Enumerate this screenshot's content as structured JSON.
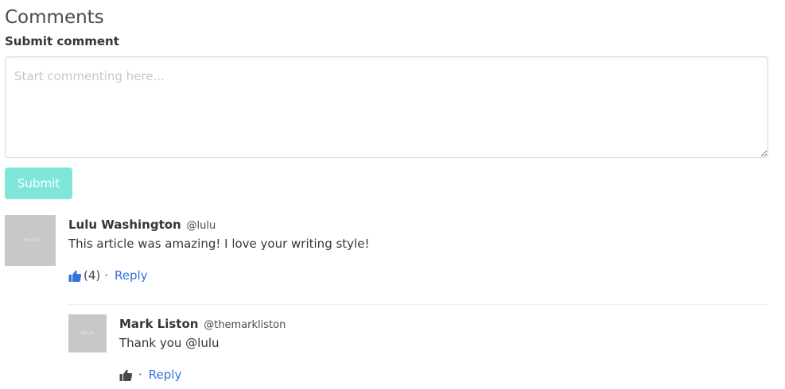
{
  "page": {
    "heading": "Comments"
  },
  "form": {
    "label": "Submit comment",
    "placeholder": "Start commenting here...",
    "value": "",
    "submit_label": "Submit"
  },
  "comments": [
    {
      "avatar_text": "128×128",
      "author_name": "Lulu Washington",
      "author_handle": "@lulu",
      "body": "This article was amazing! I love your writing style!",
      "like_icon": "thumbs-up-icon",
      "like_count": "(4)",
      "separator": "·",
      "reply_label": "Reply"
    },
    {
      "avatar_text": "96×96",
      "author_name": "Mark Liston",
      "author_handle": "@themarkliston",
      "body": "Thank you @lulu",
      "like_icon": "thumbs-up-icon",
      "like_count": "",
      "separator": "·",
      "reply_label": "Reply"
    }
  ],
  "colors": {
    "accent": "#7fe6d9",
    "link": "#3273dc",
    "like_active": "#3273dc",
    "like_inactive": "#4a4a4a",
    "avatar_placeholder": "#c8c8c8"
  }
}
